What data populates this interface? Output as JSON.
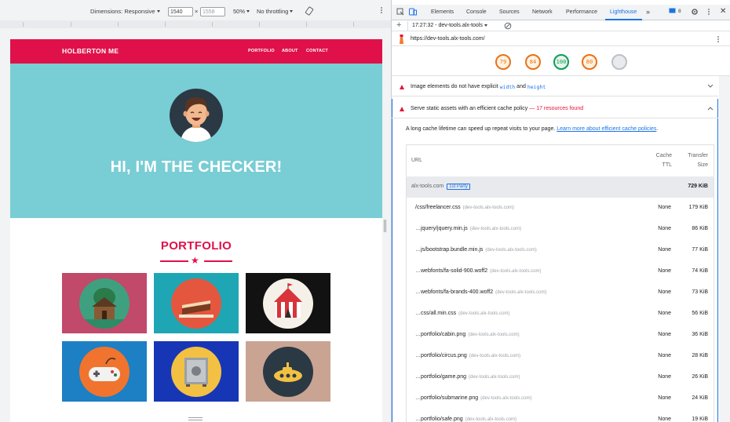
{
  "device_toolbar": {
    "dimensions_label": "Dimensions: Responsive",
    "width": "1540",
    "times": "×",
    "height_placeholder": "1558",
    "zoom": "50%",
    "throttling": "No throttling"
  },
  "site": {
    "brand": "HOLBERTON ME",
    "nav": [
      "PORTFOLIO",
      "ABOUT",
      "CONTACT"
    ],
    "hero_title": "HI, I'M THE CHECKER!",
    "portfolio_title": "PORTFOLIO",
    "tiles": [
      {
        "name": "cabin",
        "bg": "#c1496a",
        "circle": "#3fa080"
      },
      {
        "name": "cake",
        "bg": "#1fa6b5",
        "circle": "#e4573e"
      },
      {
        "name": "circus",
        "bg": "#121212",
        "circle": "#f5f1e8"
      },
      {
        "name": "game",
        "bg": "#1d7fc4",
        "circle": "#f0742e"
      },
      {
        "name": "safe",
        "bg": "#1736b6",
        "circle": "#f2c144"
      },
      {
        "name": "submarine",
        "bg": "#c9a493",
        "circle": "#2b3944"
      }
    ],
    "colors": {
      "primary": "#e0114a",
      "hero": "#79cdd4"
    }
  },
  "devtools": {
    "tabs": [
      "Elements",
      "Console",
      "Sources",
      "Network",
      "Performance",
      "Lighthouse"
    ],
    "active_tab": "Lighthouse",
    "more": "»",
    "issues_count": "8",
    "report_label": "17:27:32 - dev-tools.alx-tools",
    "url": "https://dev-tools.alx-tools.com/",
    "scores": [
      {
        "value": "79",
        "color": "#e8711a",
        "fill": "#fff3e0"
      },
      {
        "value": "84",
        "color": "#e8711a",
        "fill": "#fff3e0"
      },
      {
        "value": "100",
        "color": "#0c9d58",
        "fill": "#e6f4ea"
      },
      {
        "value": "80",
        "color": "#e8711a",
        "fill": "#fff3e0"
      },
      {
        "value": "",
        "color": "#bdc1c6",
        "fill": "#e8eaed"
      }
    ],
    "audit1": {
      "text": "Image elements do not have explicit",
      "code1": "width",
      "and": "and",
      "code2": "height"
    },
    "audit2": {
      "text": "Serve static assets with an efficient cache policy",
      "dash": "—",
      "count": "17 resources found"
    },
    "description": "A long cache lifetime can speed up repeat visits to your page.",
    "learn_more": "Learn more about efficient cache policies",
    "table": {
      "col_url": "URL",
      "col_ttl_1": "Cache",
      "col_ttl_2": "TTL",
      "col_size_1": "Transfer",
      "col_size_2": "Size",
      "group": {
        "name": "alx-tools.com",
        "badge": "1st Party",
        "size": "729 KiB"
      },
      "rows": [
        {
          "url": "/css/freelancer.css",
          "host": "(dev-tools.alx-tools.com)",
          "ttl": "None",
          "size": "179 KiB"
        },
        {
          "url": "…jquery/jquery.min.js",
          "host": "(dev-tools.alx-tools.com)",
          "ttl": "None",
          "size": "86 KiB"
        },
        {
          "url": "…js/bootstrap.bundle.min.js",
          "host": "(dev-tools.alx-tools.com)",
          "ttl": "None",
          "size": "77 KiB"
        },
        {
          "url": "…webfonts/fa-solid-900.woff2",
          "host": "(dev-tools.alx-tools.com)",
          "ttl": "None",
          "size": "74 KiB"
        },
        {
          "url": "…webfonts/fa-brands-400.woff2",
          "host": "(dev-tools.alx-tools.com)",
          "ttl": "None",
          "size": "73 KiB"
        },
        {
          "url": "…css/all.min.css",
          "host": "(dev-tools.alx-tools.com)",
          "ttl": "None",
          "size": "56 KiB"
        },
        {
          "url": "…portfolio/cabin.png",
          "host": "(dev-tools.alx-tools.com)",
          "ttl": "None",
          "size": "36 KiB"
        },
        {
          "url": "…portfolio/circus.png",
          "host": "(dev-tools.alx-tools.com)",
          "ttl": "None",
          "size": "28 KiB"
        },
        {
          "url": "…portfolio/game.png",
          "host": "(dev-tools.alx-tools.com)",
          "ttl": "None",
          "size": "26 KiB"
        },
        {
          "url": "…portfolio/submarine.png",
          "host": "(dev-tools.alx-tools.com)",
          "ttl": "None",
          "size": "24 KiB"
        },
        {
          "url": "…portfolio/safe.png",
          "host": "(dev-tools.alx-tools.com)",
          "ttl": "None",
          "size": "19 KiB"
        }
      ]
    }
  }
}
